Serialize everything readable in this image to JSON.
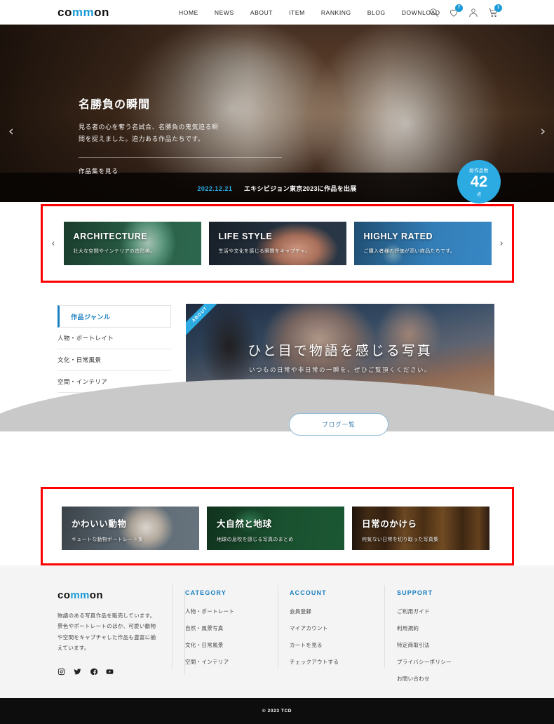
{
  "header": {
    "logo": {
      "part1": "co",
      "part2": "mm",
      "part3": "on"
    },
    "nav": [
      {
        "label": "HOME"
      },
      {
        "label": "NEWS"
      },
      {
        "label": "ABOUT"
      },
      {
        "label": "ITEM"
      },
      {
        "label": "RANKING"
      },
      {
        "label": "BLOG"
      },
      {
        "label": "DOWNLOAD"
      }
    ],
    "icons": {
      "search": "search-icon",
      "wishlist": "heart-icon",
      "wishlist_count": "7",
      "account": "user-icon",
      "cart": "cart-icon",
      "cart_count": "1"
    }
  },
  "hero": {
    "title": "名勝負の瞬間",
    "desc_line1": "見る者の心を奪う名試合、名勝負の鬼気迫る瞬",
    "desc_line2": "間を捉えました。迫力ある作品たちです。",
    "button": "作品集を見る",
    "prev_arrow": "‹",
    "next_arrow": "›",
    "badge": {
      "label": "総作品数",
      "value": "42",
      "unit": "点"
    },
    "ticker": {
      "date": "2022.12.21",
      "text": "エキシビジョン東京2023に作品を出展"
    }
  },
  "categories": {
    "prev_arrow": "‹",
    "next_arrow": "›",
    "cards": [
      {
        "title": "ARCHITECTURE",
        "subtitle": "壮大な空間やインテリアの造形美。",
        "bg": "bg-arch"
      },
      {
        "title": "LIFE STYLE",
        "subtitle": "生活や文化を感じる瞬間をキャプチャ。",
        "bg": "bg-life"
      },
      {
        "title": "HIGHLY RATED",
        "subtitle": "ご購入者様の評価が高い商品たちです。",
        "bg": "bg-high"
      }
    ]
  },
  "genre": {
    "heading": "作品ジャンル",
    "items": [
      {
        "label": "人物・ポートレイト"
      },
      {
        "label": "文化・日常風景"
      },
      {
        "label": "空間・インテリア"
      }
    ]
  },
  "about": {
    "ribbon": "ABOUT",
    "title": "ひと目で物語を感じる写真",
    "subtitle": "いつもの日常や非日常の一瞬を、ぜひご覧頂くください。"
  },
  "blog_button": {
    "label": "ブログ一覧"
  },
  "collections": {
    "cards": [
      {
        "title": "かわいい動物",
        "subtitle": "キュートな動物ポートレート集",
        "bg": "bg-animal"
      },
      {
        "title": "大自然と地球",
        "subtitle": "地球の息吹を感じる写真のまとめ",
        "bg": "bg-nature"
      },
      {
        "title": "日常のかけら",
        "subtitle": "何気ない日常を切り取った写真集",
        "bg": "bg-daily"
      }
    ]
  },
  "footer": {
    "logo": {
      "part1": "co",
      "part2": "mm",
      "part3": "on"
    },
    "description_lines": [
      "物語のある写真作品を販売しています。",
      "景色やポートレートのほか、可愛い動物",
      "や空間をキャプチャした作品も豊富に揃",
      "えています。"
    ],
    "social": [
      {
        "name": "instagram-icon"
      },
      {
        "name": "twitter-icon"
      },
      {
        "name": "facebook-icon"
      },
      {
        "name": "youtube-icon"
      }
    ],
    "columns": [
      {
        "heading": "CATEGORY",
        "links": [
          {
            "label": "人物・ポートレート"
          },
          {
            "label": "自然・風景写真"
          },
          {
            "label": "文化・日常風景"
          },
          {
            "label": "空間・インテリア"
          }
        ]
      },
      {
        "heading": "ACCOUNT",
        "links": [
          {
            "label": "会員登録"
          },
          {
            "label": "マイアカウント"
          },
          {
            "label": "カートを見る"
          },
          {
            "label": "チェックアウトする"
          }
        ]
      },
      {
        "heading": "SUPPORT",
        "links": [
          {
            "label": "ご利用ガイド"
          },
          {
            "label": "利用規約"
          },
          {
            "label": "特定商取引法"
          },
          {
            "label": "プライバシーポリシー"
          },
          {
            "label": "お問い合わせ"
          }
        ]
      }
    ],
    "copyright": "© 2023 TCD"
  },
  "colors": {
    "accent_blue": "#1a9ad6",
    "badge_blue": "#2babe2",
    "link_blue": "#1a7fc1",
    "highlight_red": "#ff0000"
  }
}
